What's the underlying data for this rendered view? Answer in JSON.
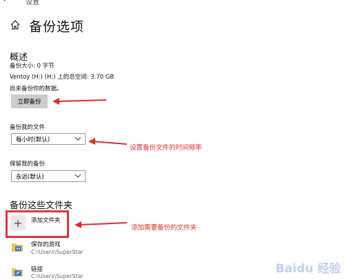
{
  "window": {
    "title": "设置"
  },
  "page": {
    "title": "备份选项"
  },
  "overview": {
    "heading": "概述",
    "backup_size": "备份大小: 0 字节",
    "drive_space": "Ventoy (H:) (H:) 上的总空间: 3.70 GB",
    "status": "尚未备份你的数据。",
    "backup_now_label": "立即备份"
  },
  "schedule": {
    "label": "备份我的文件",
    "selected": "每小时(默认)"
  },
  "retention": {
    "label": "保留我的备份",
    "selected": "永远(默认)"
  },
  "folders": {
    "heading": "备份这些文件夹",
    "add_label": "添加文件夹",
    "items": [
      {
        "name": "保存的游戏",
        "path": "C:\\Users\\SuperStar"
      },
      {
        "name": "链接",
        "path": "C:\\Users\\SuperStar"
      }
    ]
  },
  "annotations": {
    "frequency_note": "设置备份文件的时间频率",
    "add_folder_note": "添加需要备份的文件夹",
    "color": "#e02b2b"
  },
  "watermark": {
    "text": "Baidu 经验"
  }
}
